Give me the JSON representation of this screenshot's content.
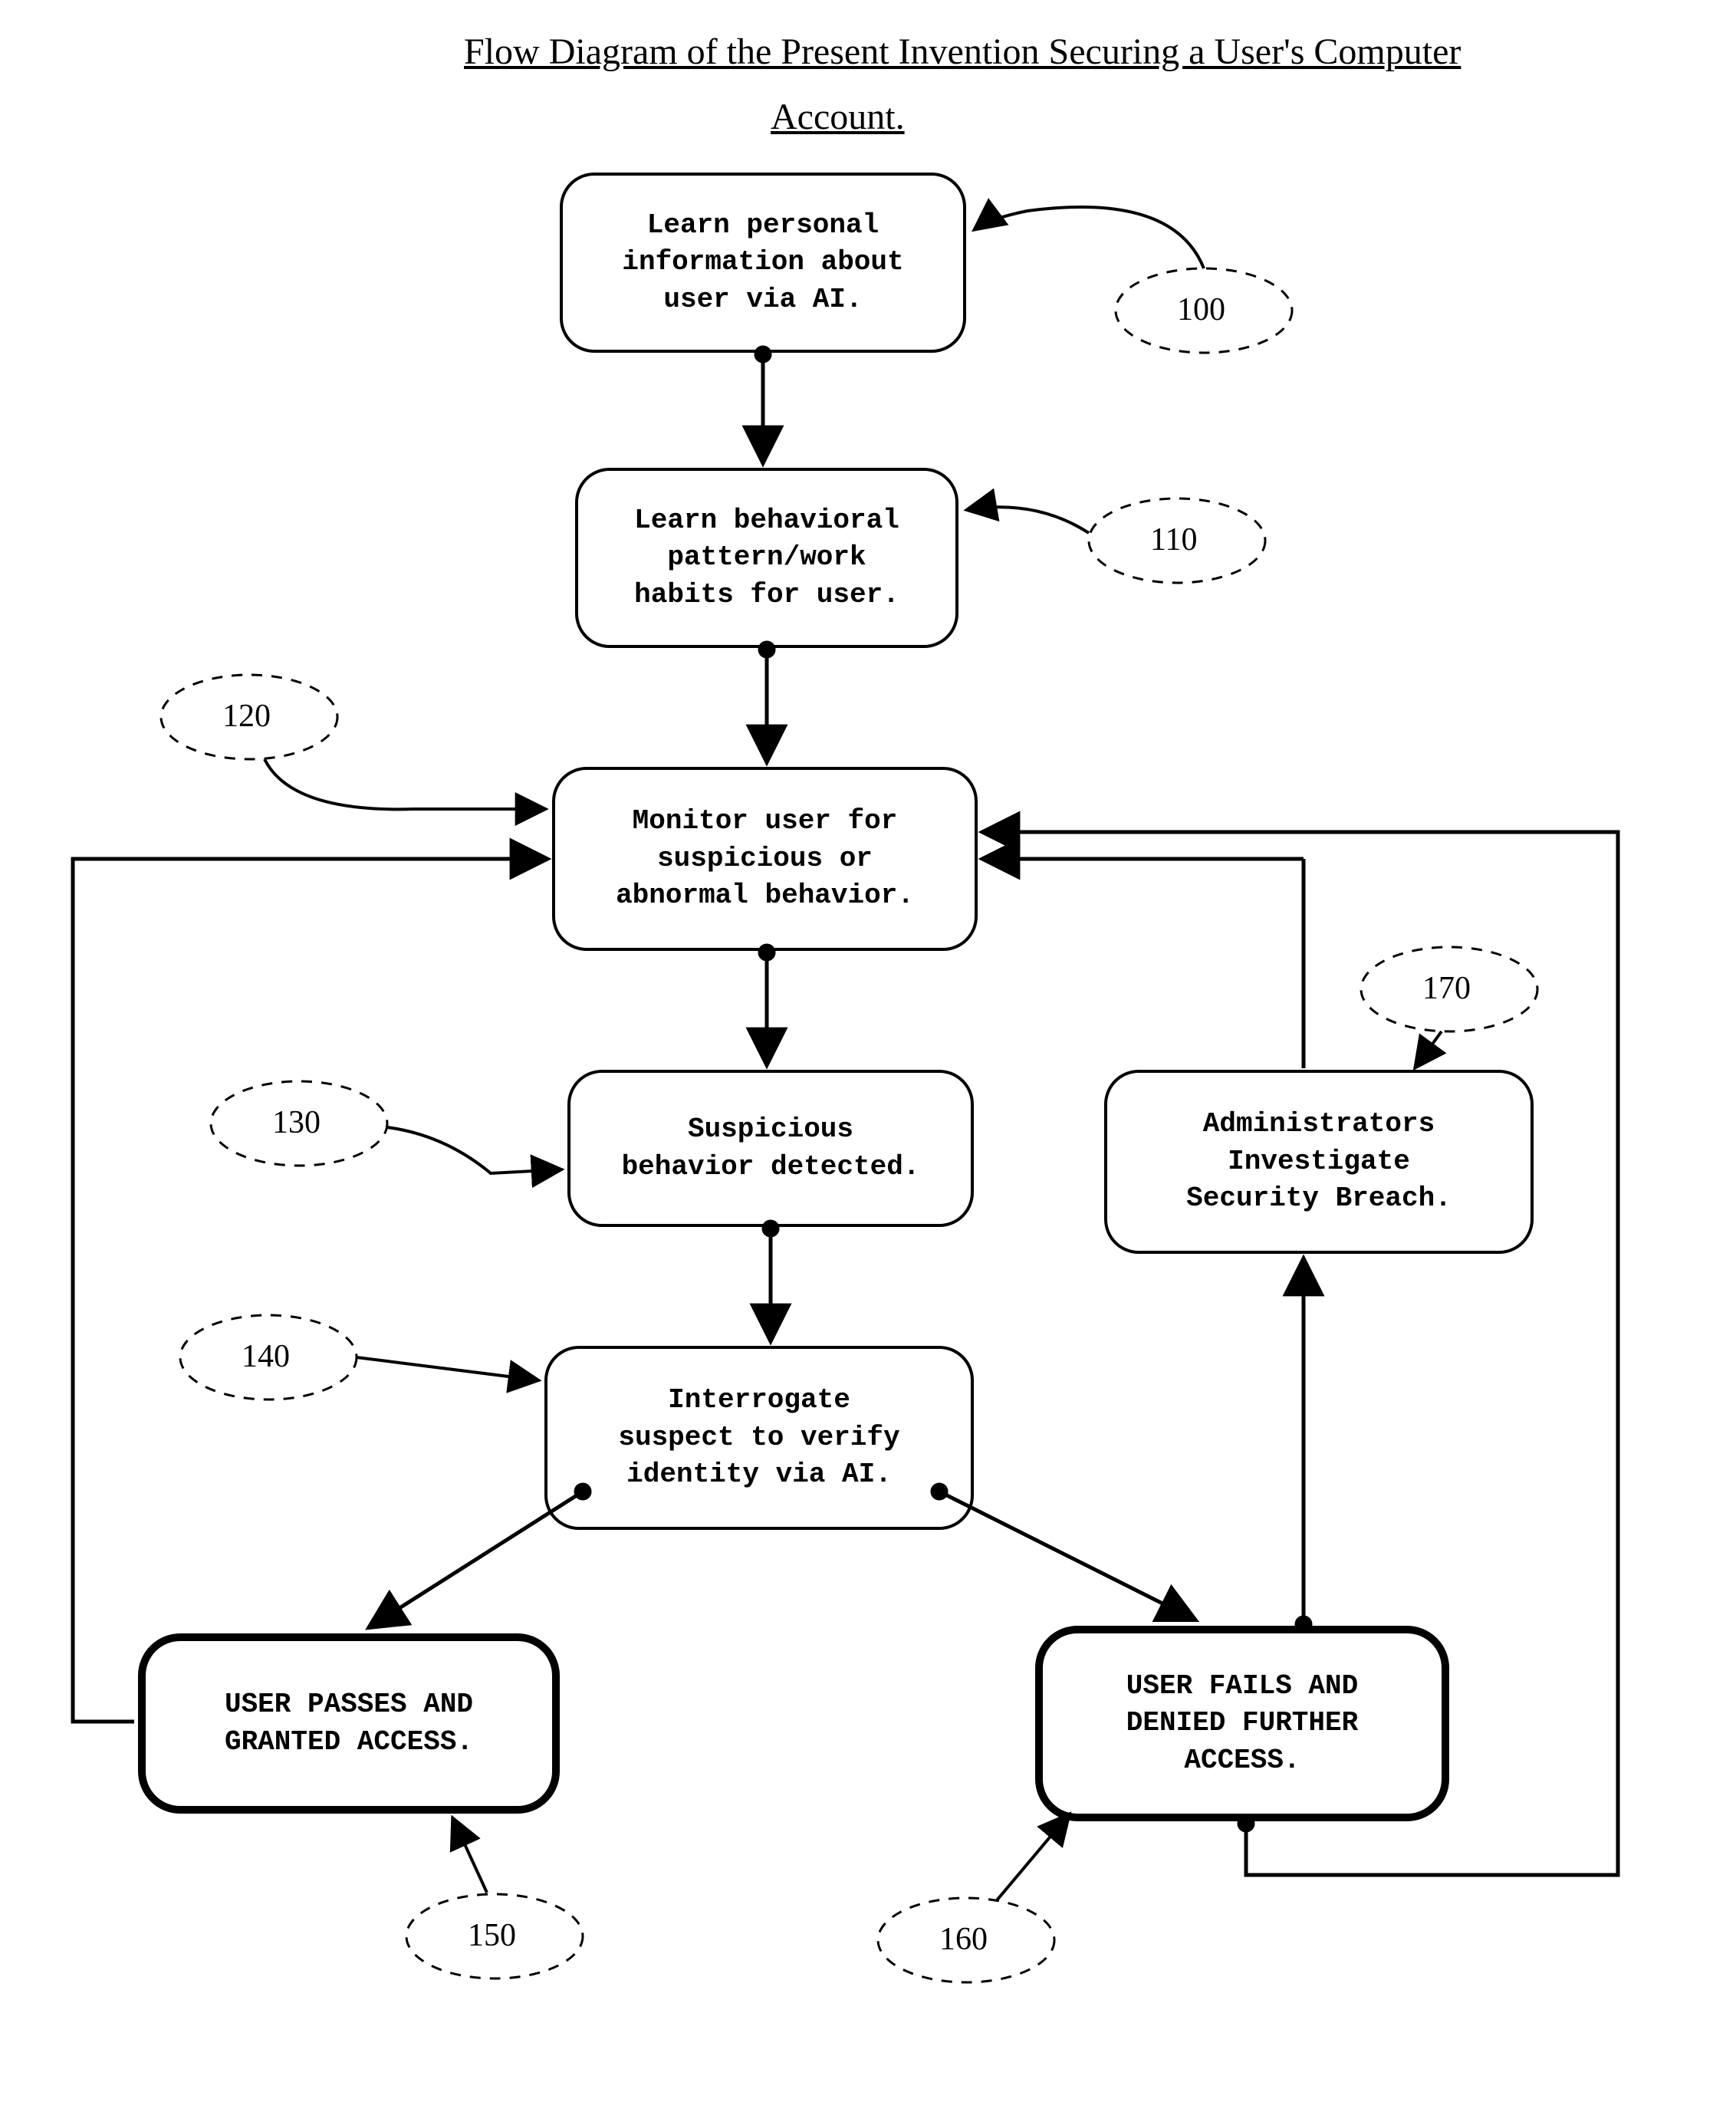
{
  "title_line1": "Flow Diagram of the Present Invention Securing a User's Computer",
  "title_line2": "Account.",
  "nodes": {
    "n100": "Learn personal\ninformation about\nuser via AI.",
    "n110": "Learn behavioral\npattern/work\nhabits for user.",
    "n120": "Monitor user for\nsuspicious or\nabnormal behavior.",
    "n130": "Suspicious\nbehavior detected.",
    "n140": "Interrogate\nsuspect to verify\nidentity via AI.",
    "n150": "USER PASSES AND\nGRANTED ACCESS.",
    "n160": "USER FAILS AND\nDENIED FURTHER\nACCESS.",
    "n170": "Administrators\nInvestigate\nSecurity Breach."
  },
  "refs": {
    "r100": "100",
    "r110": "110",
    "r120": "120",
    "r130": "130",
    "r140": "140",
    "r150": "150",
    "r160": "160",
    "r170": "170"
  }
}
